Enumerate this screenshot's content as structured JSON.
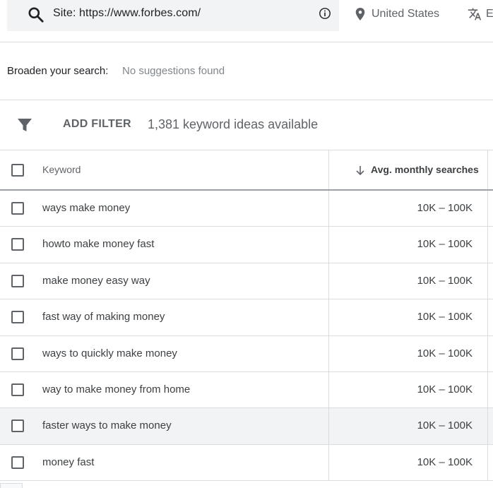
{
  "search": {
    "query": "Site: https://www.forbes.com/",
    "location": "United States",
    "language": "En"
  },
  "broaden": {
    "label": "Broaden your search:",
    "value": "No suggestions found"
  },
  "filter": {
    "add_filter_label": "ADD FILTER",
    "ideas_count": "1,381 keyword ideas available"
  },
  "table": {
    "headers": {
      "keyword": "Keyword",
      "avg_monthly_searches": "Avg. monthly searches"
    },
    "rows": [
      {
        "keyword": "ways make money",
        "avg": "10K – 100K"
      },
      {
        "keyword": "howto make money fast",
        "avg": "10K – 100K"
      },
      {
        "keyword": "make money easy way",
        "avg": "10K – 100K"
      },
      {
        "keyword": "fast way of making money",
        "avg": "10K – 100K"
      },
      {
        "keyword": "ways to quickly make money",
        "avg": "10K – 100K"
      },
      {
        "keyword": "way to make money from home",
        "avg": "10K – 100K"
      },
      {
        "keyword": "faster ways to make money",
        "avg": "10K – 100K"
      },
      {
        "keyword": "money fast",
        "avg": "10K – 100K"
      }
    ]
  },
  "icons": {
    "search": "search-icon",
    "info": "info-icon",
    "location": "location-pin-icon",
    "language": "translate-icon",
    "filter": "filter-icon",
    "sort": "arrow-down-icon"
  },
  "colors": {
    "searchbox_bg": "#f1f3f4",
    "hover_row_bg": "#f1f3f4",
    "divider": "#dadce0"
  }
}
